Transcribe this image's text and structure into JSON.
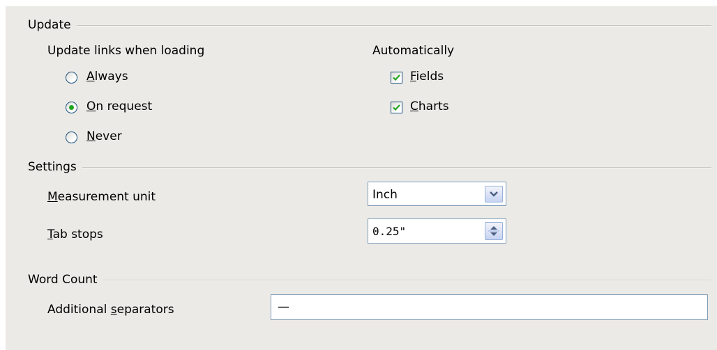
{
  "update": {
    "section_label": "Update",
    "links_label": "Update links when loading",
    "options": [
      {
        "before": "",
        "mnemonic": "A",
        "after": "lways",
        "selected": false
      },
      {
        "before": "",
        "mnemonic": "O",
        "after": "n request",
        "selected": true
      },
      {
        "before": "",
        "mnemonic": "N",
        "after": "ever",
        "selected": false
      }
    ],
    "automatically_label": "Automatically",
    "checkboxes": [
      {
        "before": "",
        "mnemonic": "F",
        "after": "ields",
        "checked": true
      },
      {
        "before": "",
        "mnemonic": "C",
        "after": "harts",
        "checked": true
      }
    ]
  },
  "settings": {
    "section_label": "Settings",
    "measurement": {
      "before": "",
      "mnemonic": "M",
      "after": "easurement unit",
      "value": "Inch"
    },
    "tabstops": {
      "before": "",
      "mnemonic": "T",
      "after": "ab stops",
      "value": "0.25\""
    }
  },
  "word_count": {
    "section_label": "Word Count",
    "separators": {
      "before": "Additional ",
      "mnemonic": "s",
      "after": "eparators",
      "value": "—"
    }
  },
  "colors": {
    "panel": "#ebeae6",
    "check": "#23a61f",
    "control_border": "#1d5180",
    "field_border": "#7f9db9"
  }
}
